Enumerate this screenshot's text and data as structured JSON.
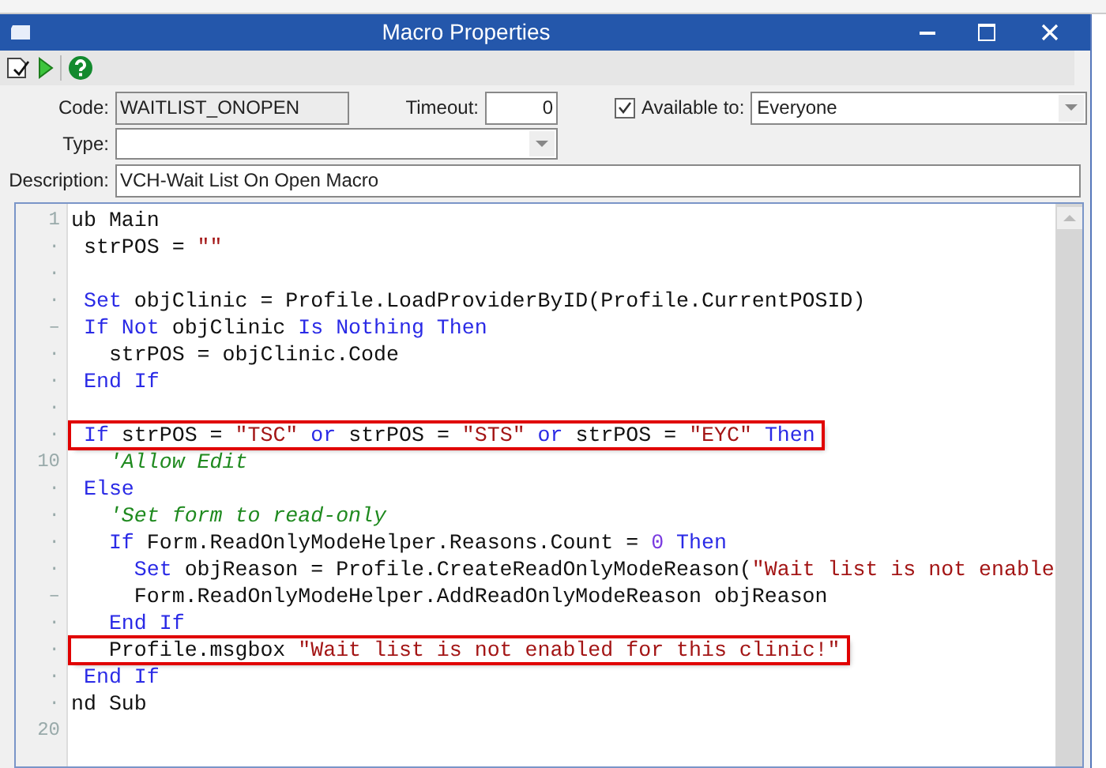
{
  "window": {
    "title": "Macro Properties"
  },
  "form": {
    "code_label": "Code:",
    "code_value": "WAITLIST_ONOPEN",
    "timeout_label": "Timeout:",
    "timeout_value": "0",
    "available": {
      "label": "Available to:",
      "checked": true
    },
    "available_value": "Everyone",
    "type_label": "Type:",
    "description_label": "Description:",
    "description_value": "VCH-Wait List On Open Macro"
  },
  "editor": {
    "lines": [
      {
        "gutter": "1",
        "tokens": [
          {
            "kind": "plain",
            "text": "ub Main"
          }
        ]
      },
      {
        "gutter": "·",
        "tokens": [
          {
            "kind": "plain",
            "text": " strPOS = "
          },
          {
            "kind": "string",
            "text": "\"\""
          }
        ]
      },
      {
        "gutter": "·"
      },
      {
        "gutter": "·",
        "tokens": [
          {
            "kind": "keyword",
            "text": " Set"
          },
          {
            "kind": "plain",
            "text": " objClinic = Profile.LoadProviderByID(Profile.CurrentPOSID)"
          }
        ]
      },
      {
        "gutter": "–",
        "tokens": [
          {
            "kind": "keyword",
            "text": " If Not"
          },
          {
            "kind": "plain",
            "text": " objClinic "
          },
          {
            "kind": "keyword",
            "text": "Is Nothing Then"
          }
        ]
      },
      {
        "gutter": "·",
        "tokens": [
          {
            "kind": "plain",
            "text": "   strPOS = objClinic.Code"
          }
        ]
      },
      {
        "gutter": "·",
        "tokens": [
          {
            "kind": "keyword",
            "text": " End If"
          }
        ]
      },
      {
        "gutter": "·"
      },
      {
        "gutter": "·",
        "highlighted": true,
        "tokens": [
          {
            "kind": "keyword",
            "text": " If"
          },
          {
            "kind": "plain",
            "text": " strPOS = "
          },
          {
            "kind": "string",
            "text": "\"TSC\""
          },
          {
            "kind": "keyword",
            "text": " or"
          },
          {
            "kind": "plain",
            "text": " strPOS = "
          },
          {
            "kind": "string",
            "text": "\"STS\""
          },
          {
            "kind": "keyword",
            "text": " or"
          },
          {
            "kind": "plain",
            "text": " strPOS = "
          },
          {
            "kind": "string",
            "text": "\"EYC\""
          },
          {
            "kind": "keyword",
            "text": " Then"
          }
        ]
      },
      {
        "gutter": "10",
        "tokens": [
          {
            "kind": "comment",
            "text": "   'Allow Edit"
          }
        ]
      },
      {
        "gutter": "·",
        "tokens": [
          {
            "kind": "keyword",
            "text": " Else"
          }
        ]
      },
      {
        "gutter": "·",
        "tokens": [
          {
            "kind": "comment",
            "text": "   'Set form to read-only"
          }
        ]
      },
      {
        "gutter": "·",
        "tokens": [
          {
            "kind": "keyword",
            "text": "   If"
          },
          {
            "kind": "plain",
            "text": " Form.ReadOnlyModeHelper.Reasons.Count = "
          },
          {
            "kind": "number",
            "text": "0"
          },
          {
            "kind": "keyword",
            "text": " Then"
          }
        ]
      },
      {
        "gutter": "·",
        "tokens": [
          {
            "kind": "keyword",
            "text": "     Set"
          },
          {
            "kind": "plain",
            "text": " objReason = Profile.CreateReadOnlyModeReason("
          },
          {
            "kind": "string",
            "text": "\"Wait list is not enable"
          }
        ]
      },
      {
        "gutter": "–",
        "tokens": [
          {
            "kind": "plain",
            "text": "     Form.ReadOnlyModeHelper.AddReadOnlyModeReason objReason"
          }
        ]
      },
      {
        "gutter": "·",
        "tokens": [
          {
            "kind": "keyword",
            "text": "   End If"
          }
        ]
      },
      {
        "gutter": "·",
        "highlighted": true,
        "tokens": [
          {
            "kind": "plain",
            "text": "   Profile.msgbox "
          },
          {
            "kind": "string",
            "text": "\"Wait list is not enabled for this clinic!\""
          }
        ]
      },
      {
        "gutter": "·",
        "tokens": [
          {
            "kind": "keyword",
            "text": " End If"
          }
        ]
      },
      {
        "gutter": "·",
        "tokens": [
          {
            "kind": "plain",
            "text": "nd Sub"
          }
        ]
      },
      {
        "gutter": "20"
      }
    ]
  }
}
